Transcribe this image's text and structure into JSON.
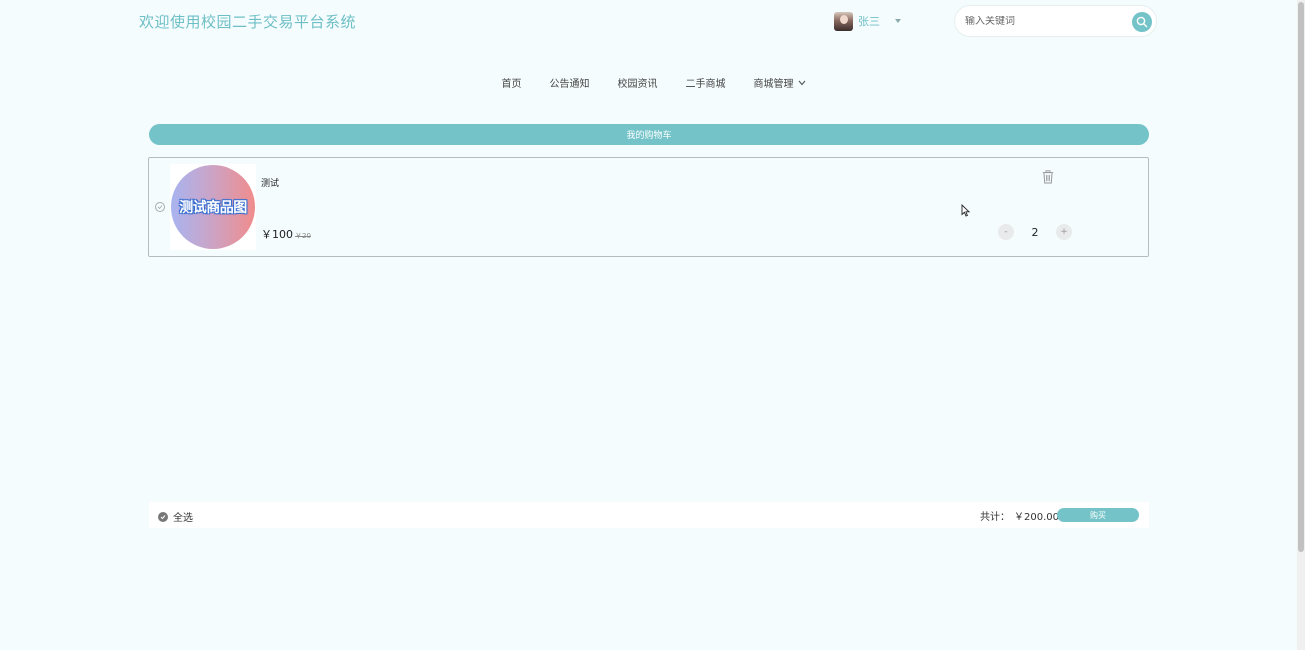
{
  "header": {
    "site_title": "欢迎使用校园二手交易平台系统",
    "user_name": "张三",
    "search_placeholder": "输入关键词"
  },
  "nav": {
    "items": [
      "首页",
      "公告通知",
      "校园资讯",
      "二手商城",
      "商城管理"
    ]
  },
  "cart": {
    "title": "我的购物车",
    "items": [
      {
        "name": "测试",
        "image_text": "测试商品图",
        "price": "￥100",
        "old_price": "￥20",
        "quantity": "2",
        "minus_label": "-",
        "plus_label": "+"
      }
    ],
    "select_all_label": "全选",
    "total_label": "共计：",
    "total_value": "￥200.00",
    "buy_label": "购买"
  },
  "colors": {
    "accent": "#73c3c8",
    "background": "#f4fcfe"
  }
}
